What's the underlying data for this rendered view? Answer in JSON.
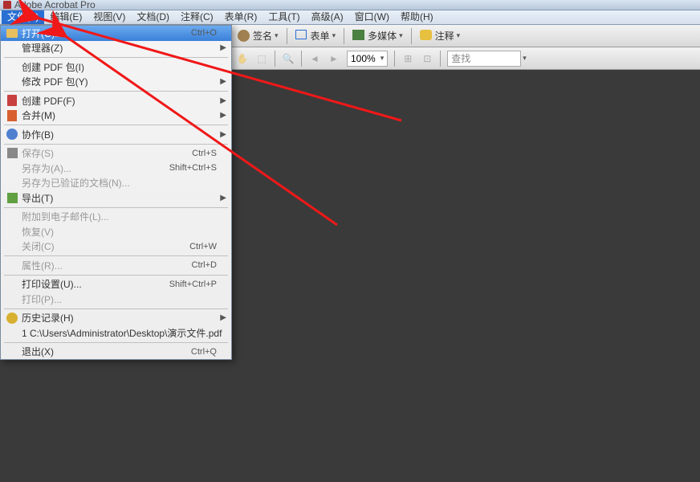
{
  "title": "Adobe Acrobat Pro",
  "menubar": [
    {
      "label": "文件(F)",
      "active": true
    },
    {
      "label": "编辑(E)"
    },
    {
      "label": "视图(V)"
    },
    {
      "label": "文档(D)"
    },
    {
      "label": "注释(C)"
    },
    {
      "label": "表单(R)"
    },
    {
      "label": "工具(T)"
    },
    {
      "label": "高级(A)"
    },
    {
      "label": "窗口(W)"
    },
    {
      "label": "帮助(H)"
    }
  ],
  "toolbar1": {
    "sign": "签名",
    "form": "表单",
    "media": "多媒体",
    "comment": "注释"
  },
  "toolbar2": {
    "zoom": "100%",
    "find": "查找"
  },
  "dropdown": [
    {
      "type": "item",
      "icon": "folder",
      "label": "打开(O)...",
      "shortcut": "Ctrl+O",
      "hover": true
    },
    {
      "type": "item",
      "label": "管理器(Z)",
      "sub": true
    },
    {
      "type": "sep"
    },
    {
      "type": "item",
      "label": "创建 PDF 包(I)"
    },
    {
      "type": "item",
      "label": "修改 PDF 包(Y)",
      "sub": true
    },
    {
      "type": "sep"
    },
    {
      "type": "item",
      "icon": "pdf",
      "label": "创建 PDF(F)",
      "sub": true
    },
    {
      "type": "item",
      "icon": "merge",
      "label": "合并(M)",
      "sub": true
    },
    {
      "type": "sep"
    },
    {
      "type": "item",
      "icon": "collab",
      "label": "协作(B)",
      "sub": true
    },
    {
      "type": "sep"
    },
    {
      "type": "item",
      "icon": "save",
      "label": "保存(S)",
      "shortcut": "Ctrl+S",
      "dis": true
    },
    {
      "type": "item",
      "label": "另存为(A)...",
      "shortcut": "Shift+Ctrl+S",
      "dis": true
    },
    {
      "type": "item",
      "label": "另存为已验证的文档(N)...",
      "dis": true
    },
    {
      "type": "item",
      "icon": "export",
      "label": "导出(T)",
      "sub": true
    },
    {
      "type": "sep"
    },
    {
      "type": "item",
      "label": "附加到电子邮件(L)...",
      "dis": true
    },
    {
      "type": "item",
      "label": "恢复(V)",
      "dis": true
    },
    {
      "type": "item",
      "label": "关闭(C)",
      "shortcut": "Ctrl+W",
      "dis": true
    },
    {
      "type": "sep"
    },
    {
      "type": "item",
      "label": "属性(R)...",
      "shortcut": "Ctrl+D",
      "dis": true
    },
    {
      "type": "sep"
    },
    {
      "type": "item",
      "label": "打印设置(U)...",
      "shortcut": "Shift+Ctrl+P"
    },
    {
      "type": "item",
      "label": "打印(P)...",
      "dis": true
    },
    {
      "type": "sep"
    },
    {
      "type": "item",
      "icon": "history",
      "label": "历史记录(H)",
      "sub": true
    },
    {
      "type": "item",
      "label": "1 C:\\Users\\Administrator\\Desktop\\演示文件.pdf"
    },
    {
      "type": "sep"
    },
    {
      "type": "item",
      "label": "退出(X)",
      "shortcut": "Ctrl+Q"
    }
  ]
}
